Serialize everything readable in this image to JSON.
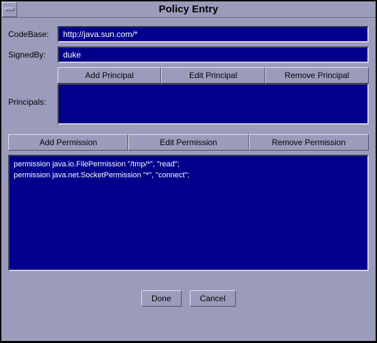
{
  "window": {
    "title": "Policy Entry"
  },
  "fields": {
    "codebase_label": "CodeBase:",
    "codebase_value": "http://java.sun.com/*",
    "signedby_label": "SignedBy:",
    "signedby_value": "duke"
  },
  "principals": {
    "label": "Principals:",
    "buttons": {
      "add": "Add Principal",
      "edit": "Edit Principal",
      "remove": "Remove Principal"
    },
    "items": []
  },
  "permissions": {
    "buttons": {
      "add": "Add Permission",
      "edit": "Edit Permission",
      "remove": "Remove Permission"
    },
    "items": [
      "permission java.io.FilePermission \"/tmp/*\", \"read\";",
      "permission java.net.SocketPermission \"*\", \"connect\";"
    ]
  },
  "dialog_buttons": {
    "done": "Done",
    "cancel": "Cancel"
  }
}
